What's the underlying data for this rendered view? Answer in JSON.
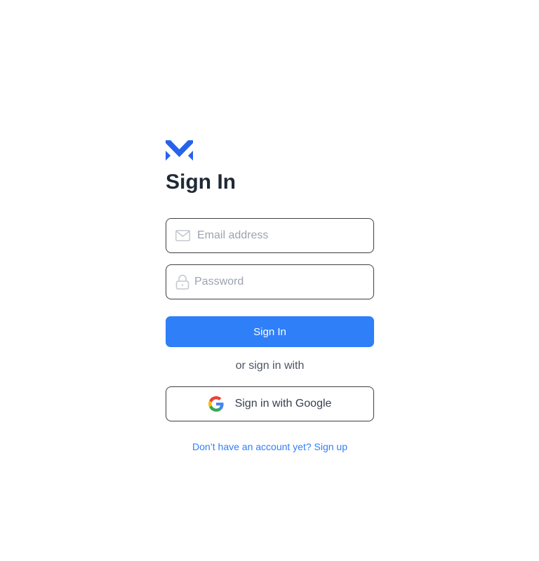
{
  "brand": {
    "logo_icon": "brand-m-logo",
    "color": "#2563eb"
  },
  "title": "Sign In",
  "form": {
    "email": {
      "icon": "envelope-icon",
      "placeholder": "Email address",
      "value": ""
    },
    "password": {
      "icon": "lock-icon",
      "placeholder": "Password",
      "value": ""
    },
    "submit_label": "Sign In"
  },
  "divider_text": "or sign in with",
  "google": {
    "icon": "google-icon",
    "label": "Sign in with Google"
  },
  "signup_link": "Don’t have an account yet? Sign up",
  "colors": {
    "primary": "#2f7ff8",
    "title": "#1f2937",
    "border": "#3f3f46",
    "link": "#2f7ff8"
  }
}
